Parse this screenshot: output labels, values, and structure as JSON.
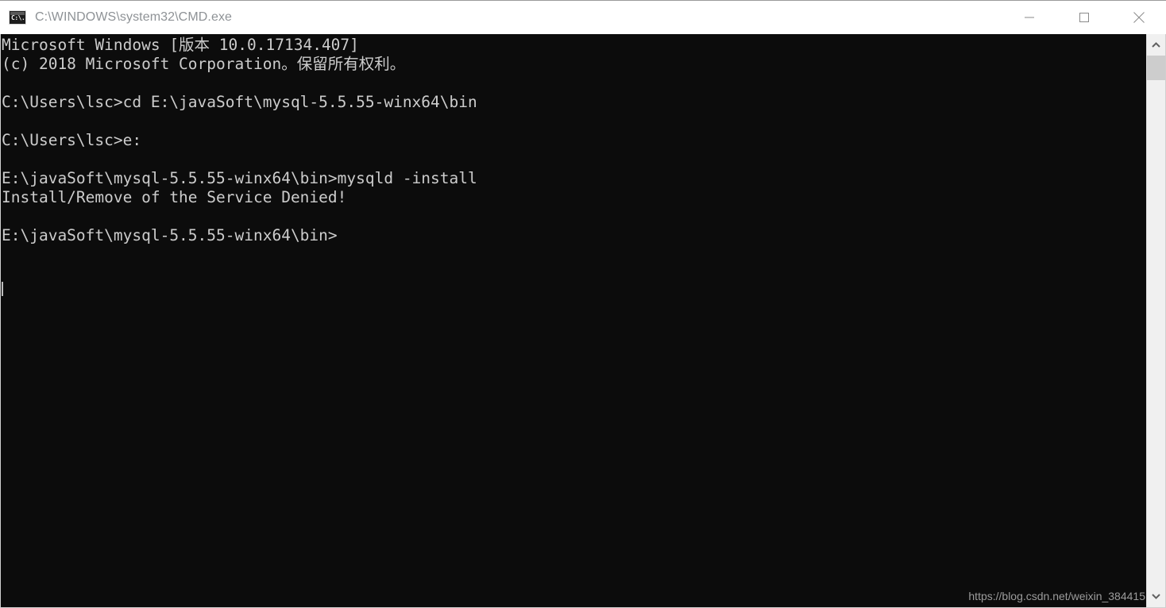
{
  "window": {
    "title": "C:\\WINDOWS\\system32\\CMD.exe",
    "icon_name": "cmd-icon",
    "icon_glyph": "C:\\.",
    "controls": {
      "minimize_label": "Minimize",
      "maximize_label": "Maximize",
      "close_label": "Close"
    },
    "colors": {
      "titlebar_bg": "#ffffff",
      "title_text": "#8e9296",
      "console_bg": "#0c0c0c",
      "console_text": "#cccccc",
      "scrollbar_track": "#f0f0f0",
      "scrollbar_thumb": "#cdcdcd"
    }
  },
  "console": {
    "lines": [
      "Microsoft Windows [版本 10.0.17134.407]",
      "(c) 2018 Microsoft Corporation。保留所有权利。",
      "",
      "C:\\Users\\lsc>cd E:\\javaSoft\\mysql-5.5.55-winx64\\bin",
      "",
      "C:\\Users\\lsc>e:",
      "",
      "E:\\javaSoft\\mysql-5.5.55-winx64\\bin>mysqld -install",
      "Install/Remove of the Service Denied!",
      "",
      "E:\\javaSoft\\mysql-5.5.55-winx64\\bin>"
    ],
    "text": "Microsoft Windows [版本 10.0.17134.407]\n(c) 2018 Microsoft Corporation。保留所有权利。\n\nC:\\Users\\lsc>cd E:\\javaSoft\\mysql-5.5.55-winx64\\bin\n\nC:\\Users\\lsc>e:\n\nE:\\javaSoft\\mysql-5.5.55-winx64\\bin>mysqld -install\nInstall/Remove of the Service Denied!\n\nE:\\javaSoft\\mysql-5.5.55-winx64\\bin>"
  },
  "watermark": {
    "text": "https://blog.csdn.net/weixin_384415"
  },
  "scrollbar": {
    "up_arrow_name": "scroll-up-arrow",
    "down_arrow_name": "scroll-down-arrow"
  }
}
